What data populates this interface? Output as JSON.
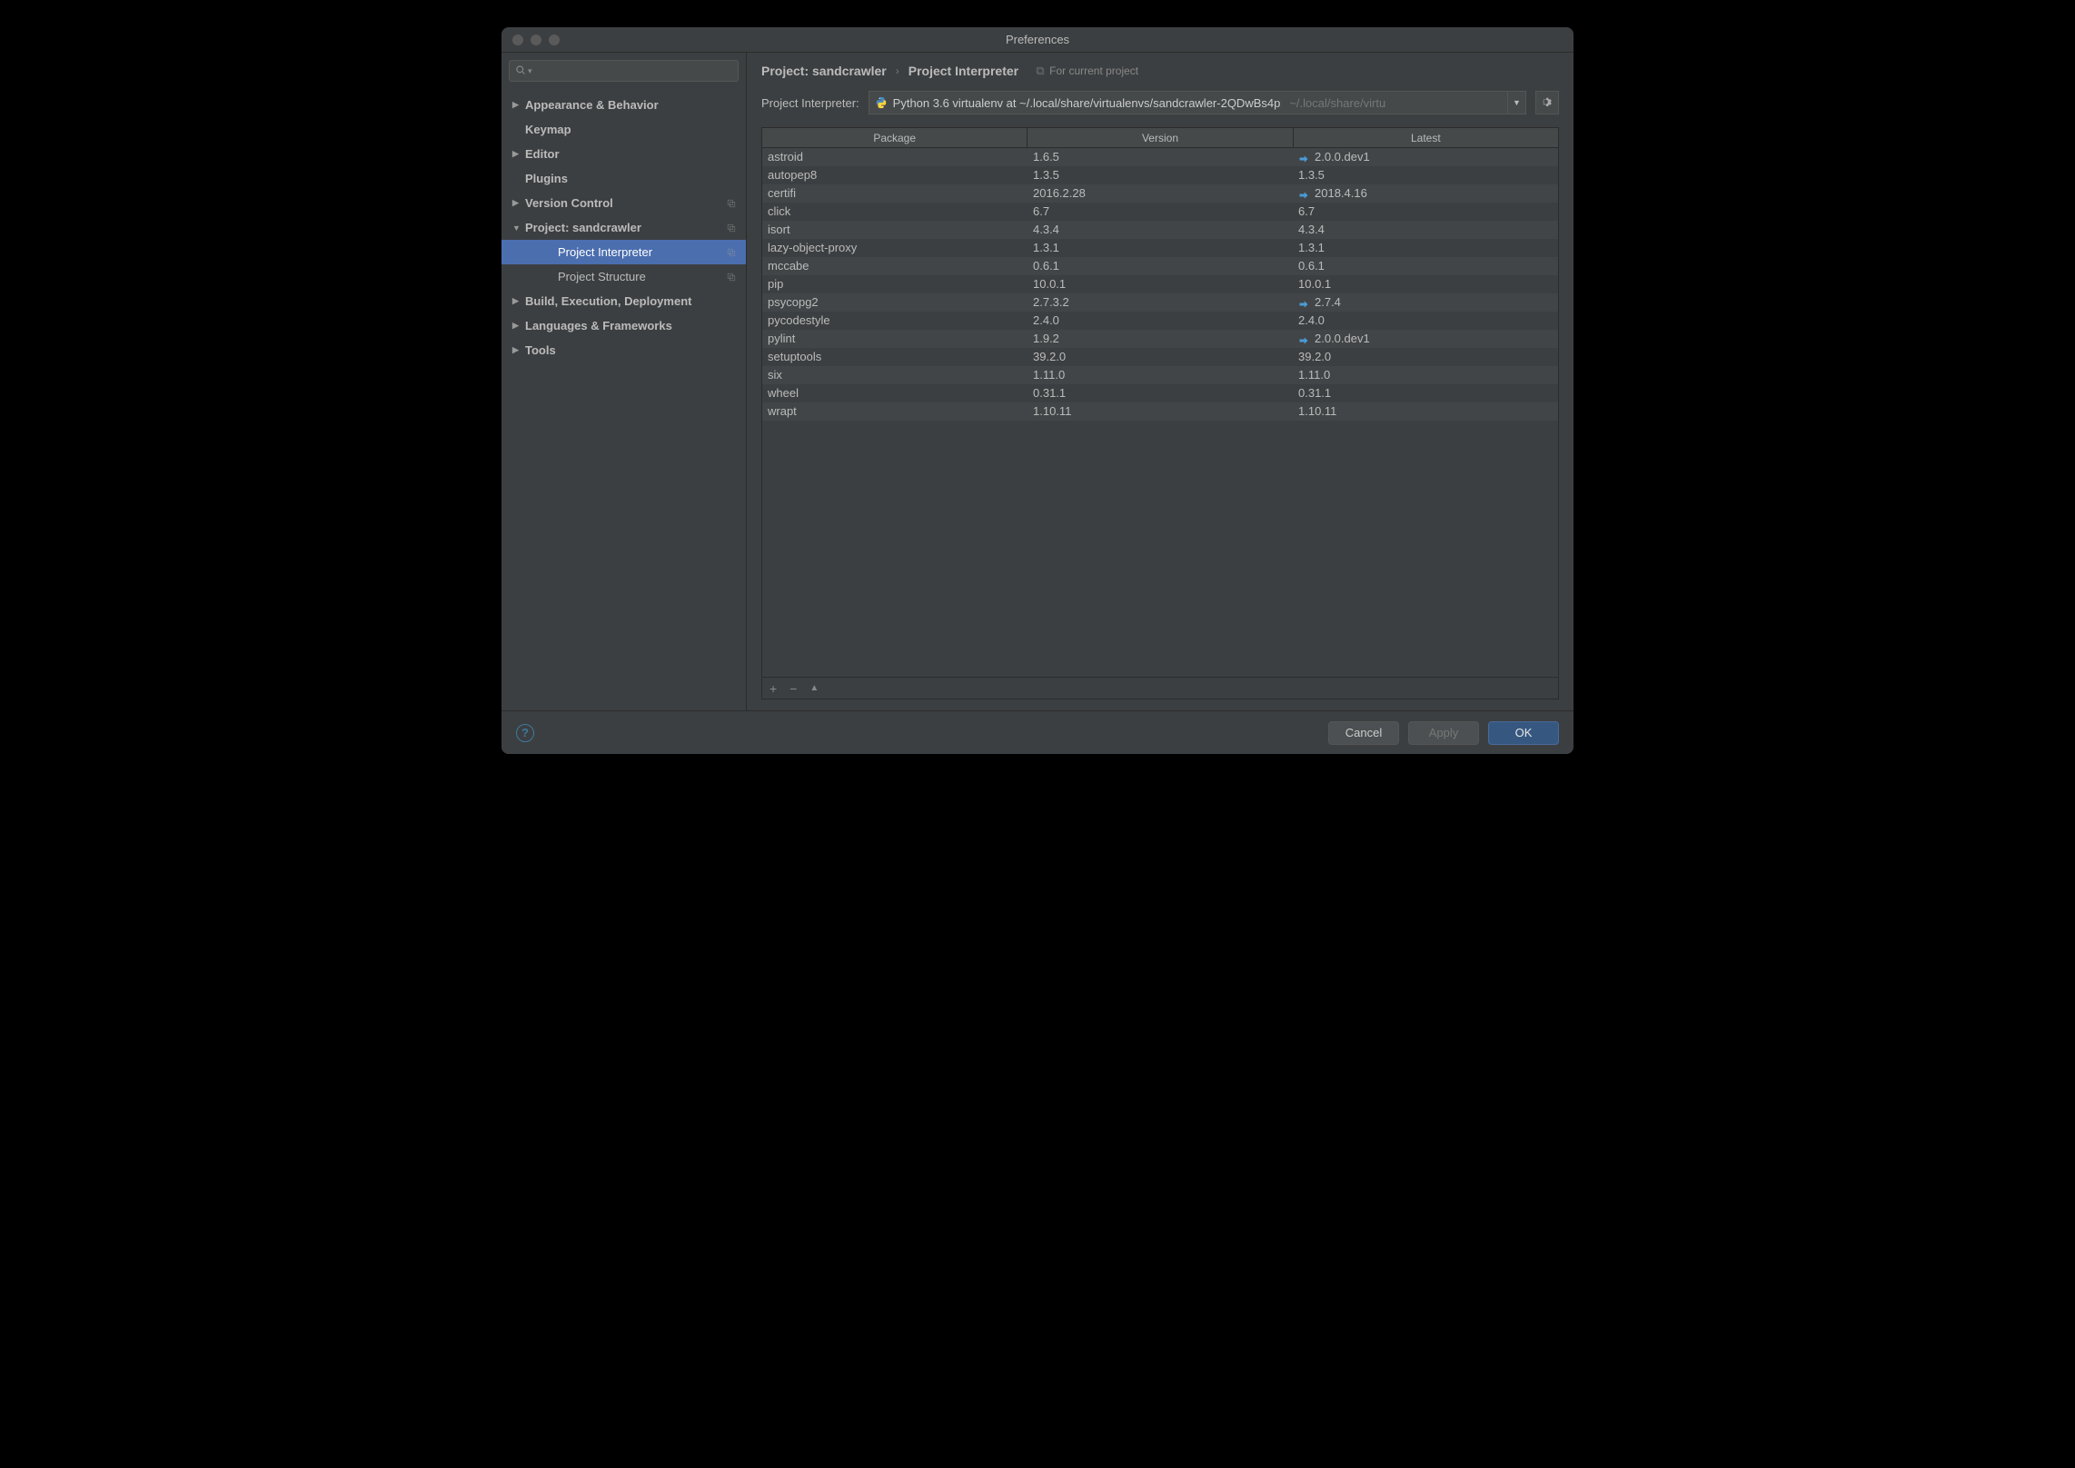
{
  "window": {
    "title": "Preferences"
  },
  "search": {
    "placeholder": "Q"
  },
  "sidebar": {
    "items": [
      {
        "label": "Appearance & Behavior",
        "level": 0,
        "arrow": "right",
        "bold": true
      },
      {
        "label": "Keymap",
        "level": 0,
        "arrow": "none",
        "bold": true
      },
      {
        "label": "Editor",
        "level": 0,
        "arrow": "right",
        "bold": true
      },
      {
        "label": "Plugins",
        "level": 0,
        "arrow": "none",
        "bold": true
      },
      {
        "label": "Version Control",
        "level": 0,
        "arrow": "right",
        "bold": true,
        "copy": true
      },
      {
        "label": "Project: sandcrawler",
        "level": 0,
        "arrow": "down",
        "bold": true,
        "copy": true
      },
      {
        "label": "Project Interpreter",
        "level": 1,
        "arrow": "none",
        "bold": false,
        "copy": true,
        "selected": true
      },
      {
        "label": "Project Structure",
        "level": 1,
        "arrow": "none",
        "bold": false,
        "copy": true
      },
      {
        "label": "Build, Execution, Deployment",
        "level": 0,
        "arrow": "right",
        "bold": true
      },
      {
        "label": "Languages & Frameworks",
        "level": 0,
        "arrow": "right",
        "bold": true
      },
      {
        "label": "Tools",
        "level": 0,
        "arrow": "right",
        "bold": true
      }
    ]
  },
  "breadcrumb": {
    "crumb1": "Project: sandcrawler",
    "crumb2": "Project Interpreter",
    "tag": "For current project"
  },
  "interpreter": {
    "label": "Project Interpreter:",
    "value": "Python 3.6 virtualenv at ~/.local/share/virtualenvs/sandcrawler-2QDwBs4p",
    "path_suffix": "~/.local/share/virtu"
  },
  "table": {
    "headers": {
      "package": "Package",
      "version": "Version",
      "latest": "Latest"
    },
    "rows": [
      {
        "package": "astroid",
        "version": "1.6.5",
        "latest": "2.0.0.dev1",
        "update": true
      },
      {
        "package": "autopep8",
        "version": "1.3.5",
        "latest": "1.3.5",
        "update": false
      },
      {
        "package": "certifi",
        "version": "2016.2.28",
        "latest": "2018.4.16",
        "update": true
      },
      {
        "package": "click",
        "version": "6.7",
        "latest": "6.7",
        "update": false
      },
      {
        "package": "isort",
        "version": "4.3.4",
        "latest": "4.3.4",
        "update": false
      },
      {
        "package": "lazy-object-proxy",
        "version": "1.3.1",
        "latest": "1.3.1",
        "update": false
      },
      {
        "package": "mccabe",
        "version": "0.6.1",
        "latest": "0.6.1",
        "update": false
      },
      {
        "package": "pip",
        "version": "10.0.1",
        "latest": "10.0.1",
        "update": false
      },
      {
        "package": "psycopg2",
        "version": "2.7.3.2",
        "latest": "2.7.4",
        "update": true
      },
      {
        "package": "pycodestyle",
        "version": "2.4.0",
        "latest": "2.4.0",
        "update": false
      },
      {
        "package": "pylint",
        "version": "1.9.2",
        "latest": "2.0.0.dev1",
        "update": true
      },
      {
        "package": "setuptools",
        "version": "39.2.0",
        "latest": "39.2.0",
        "update": false
      },
      {
        "package": "six",
        "version": "1.11.0",
        "latest": "1.11.0",
        "update": false
      },
      {
        "package": "wheel",
        "version": "0.31.1",
        "latest": "0.31.1",
        "update": false
      },
      {
        "package": "wrapt",
        "version": "1.10.11",
        "latest": "1.10.11",
        "update": false
      }
    ]
  },
  "toolbar": {
    "add": "+",
    "remove": "−",
    "upgrade": "▲"
  },
  "footer": {
    "help": "?",
    "cancel": "Cancel",
    "apply": "Apply",
    "ok": "OK"
  }
}
